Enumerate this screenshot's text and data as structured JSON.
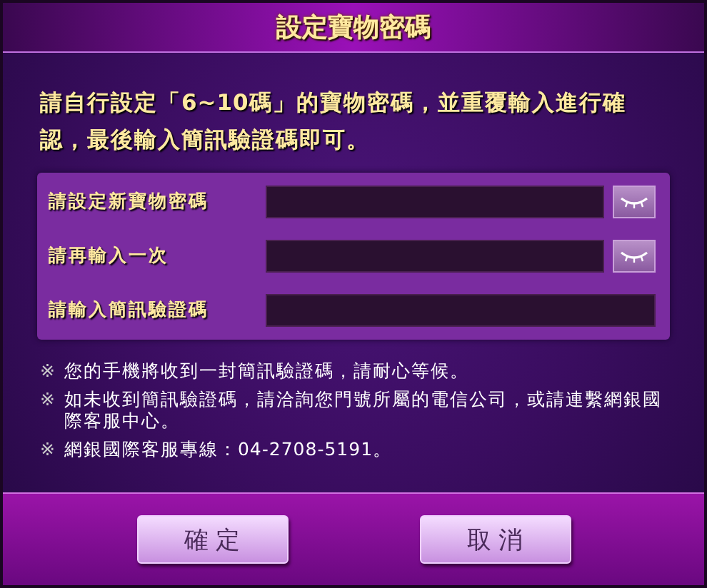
{
  "window": {
    "title": "設定寶物密碼"
  },
  "intro": "請自行設定「6~10碼」的寶物密碼，並重覆輸入進行確認，最後輸入簡訊驗證碼即可。",
  "fields": [
    {
      "label": "請設定新寶物密碼",
      "kind": "password"
    },
    {
      "label": "請再輸入一次",
      "kind": "password"
    },
    {
      "label": "請輸入簡訊驗證碼",
      "kind": "code"
    }
  ],
  "notes": [
    {
      "mark": "※",
      "text": "您的手機將收到一封簡訊驗證碼，請耐心等候。"
    },
    {
      "mark": "※",
      "text": "如未收到簡訊驗證碼，請洽詢您門號所屬的電信公司，或請連繫網銀國際客服中心。"
    },
    {
      "mark": "※",
      "text": "網銀國際客服專線：04-2708-5191。"
    }
  ],
  "buttons": [
    "確 定",
    "取 消"
  ]
}
